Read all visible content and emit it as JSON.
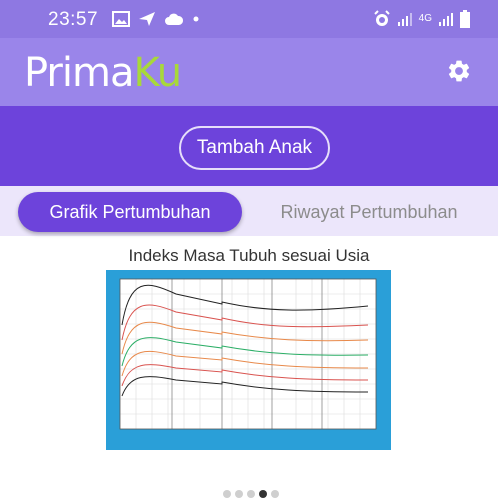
{
  "status": {
    "time": "23:57",
    "network": "4G",
    "icons": [
      "image-icon",
      "send-icon",
      "cloud-icon",
      "dot-icon",
      "alarm-icon",
      "signal-icon",
      "signal-4g-icon",
      "battery-icon"
    ]
  },
  "app": {
    "logo_part1": "Prima",
    "logo_part2": "Ku",
    "logo_colors": {
      "prima": "#ffffff",
      "ku": "#a8d83a"
    },
    "settings_icon": "gear-icon"
  },
  "actions": {
    "add_child_label": "Tambah Anak"
  },
  "tabs": [
    {
      "label": "Grafik Pertumbuhan",
      "active": true
    },
    {
      "label": "Riwayat Pertumbuhan",
      "active": false
    }
  ],
  "chart": {
    "title": "Indeks Masa Tubuh sesuai Usia",
    "image_description": "BMI-for-age growth chart"
  },
  "pager": {
    "count": 5,
    "active_index": 3
  },
  "colors": {
    "statusbar": "#8e78e2",
    "appbar": "#9a85ea",
    "band": "#6d43db",
    "tab_bg": "#ece6fb",
    "chart_frame": "#2a9fd8"
  }
}
